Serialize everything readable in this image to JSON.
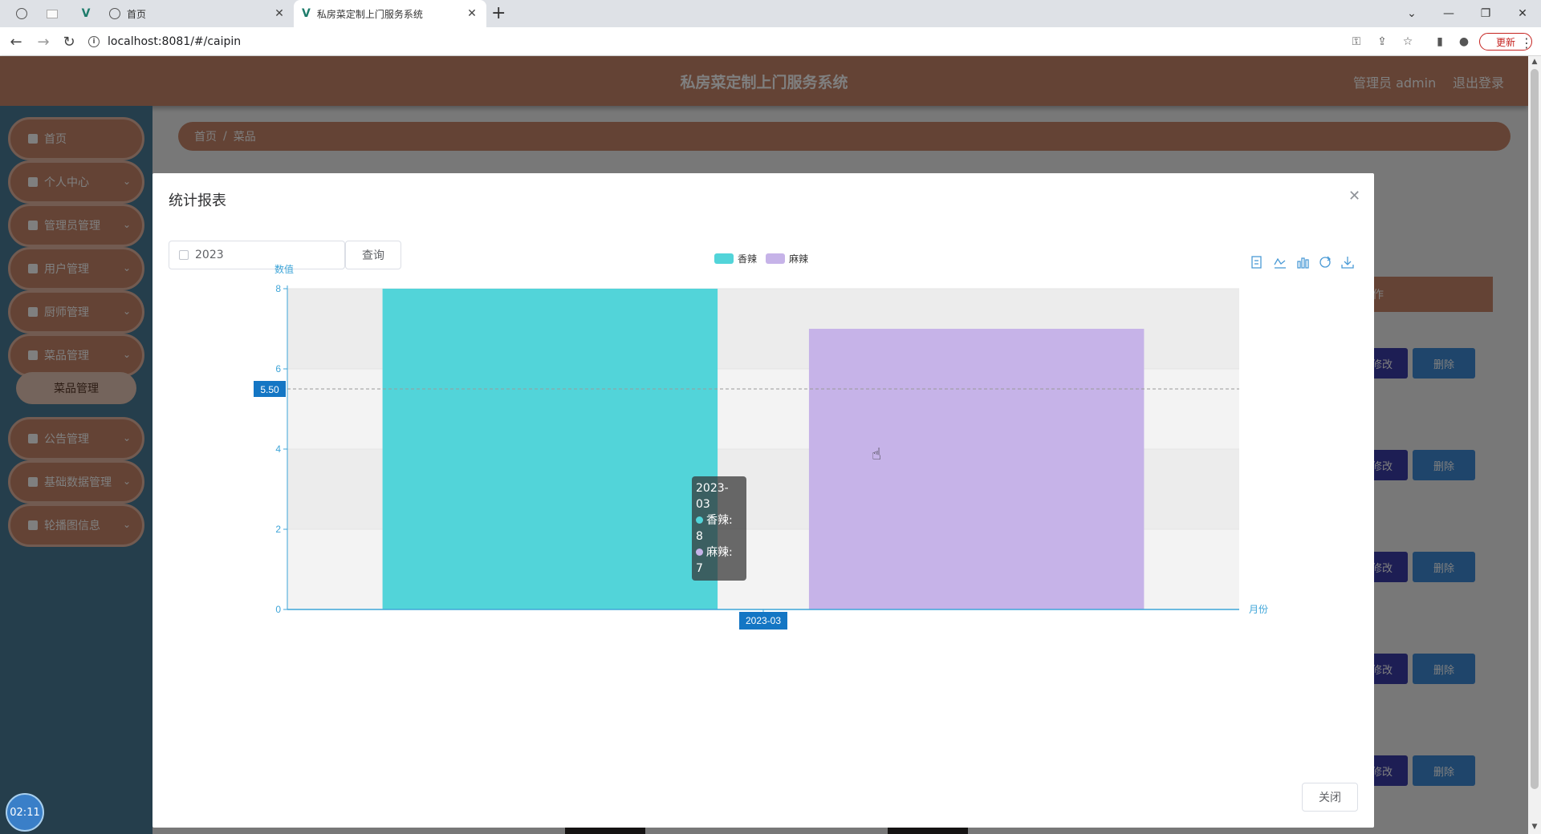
{
  "browser": {
    "tabs": [
      {
        "title": "首页"
      },
      {
        "title": "私房菜定制上门服务系统"
      }
    ],
    "url": "localhost:8081/#/caipin",
    "update_label": "更新"
  },
  "app": {
    "title": "私房菜定制上门服务系统",
    "admin_label": "管理员 admin",
    "logout_label": "退出登录",
    "sidebar": [
      {
        "label": "首页"
      },
      {
        "label": "个人中心"
      },
      {
        "label": "管理员管理"
      },
      {
        "label": "用户管理"
      },
      {
        "label": "厨师管理"
      },
      {
        "label": "菜品管理"
      },
      {
        "label": "公告管理"
      },
      {
        "label": "基础数据管理"
      },
      {
        "label": "轮播图信息"
      }
    ],
    "sidebar_sub": "菜品管理",
    "breadcrumb": [
      "首页",
      "/",
      "菜品"
    ],
    "table_header_fragment": "作",
    "row_buttons": {
      "edit": "修改",
      "delete": "删除"
    },
    "timer": "02:11"
  },
  "dialog": {
    "title": "统计报表",
    "year_value": "2023",
    "query_label": "查询",
    "close_label": "关闭",
    "tooltip": {
      "title": "2023-03",
      "lines": [
        "香辣: 8",
        "麻辣: 7"
      ]
    }
  },
  "chart_data": {
    "type": "bar",
    "categories": [
      "2023-03"
    ],
    "series": [
      {
        "name": "香辣",
        "values": [
          8
        ],
        "color": "#52d4d9"
      },
      {
        "name": "麻辣",
        "values": [
          7
        ],
        "color": "#c6b3e8"
      }
    ],
    "xlabel": "月份",
    "ylabel": "数值",
    "ylim": [
      0,
      8
    ],
    "yticks": [
      0,
      2,
      4,
      6,
      8
    ],
    "axis_pointer_value": "5.50",
    "axis_pointer_x": "2023-03",
    "legend_placement": "top-center",
    "split_area": true,
    "axis_color": "#3ea5d8",
    "toolbox": [
      "data-view-icon",
      "line-icon",
      "bar-icon",
      "restore-icon",
      "download-icon"
    ]
  }
}
